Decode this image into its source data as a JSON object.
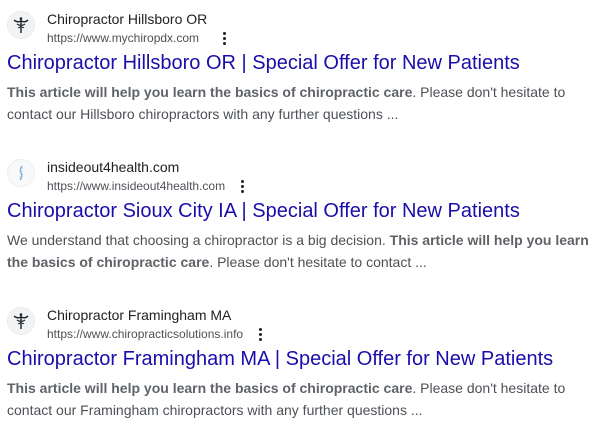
{
  "results": [
    {
      "site_name": "Chiropractor Hillsboro OR",
      "url": "https://www.mychiropdx.com",
      "favicon": "caduceus-icon",
      "title": "Chiropractor Hillsboro OR | Special Offer for New Patients",
      "snippet_bold_1": "This article will help you learn the basics of chiropractic care",
      "snippet_text_1": ". Please don't hesitate to contact our Hillsboro chiropractors with any further questions ..."
    },
    {
      "site_name": "insideout4health.com",
      "url": "https://www.insideout4health.com",
      "favicon": "spine-icon",
      "title": "Chiropractor Sioux City IA | Special Offer for New Patients",
      "snippet_text_1": "We understand that choosing a chiropractor is a big decision. ",
      "snippet_bold_1": "This article will help you learn the basics of chiropractic care",
      "snippet_text_2": ". Please don't hesitate to contact ..."
    },
    {
      "site_name": "Chiropractor Framingham MA",
      "url": "https://www.chiropracticsolutions.info",
      "favicon": "caduceus-icon",
      "title": "Chiropractor Framingham MA | Special Offer for New Patients",
      "snippet_bold_1": "This article will help you learn the basics of chiropractic care",
      "snippet_text_1": ". Please don't hesitate to contact our Framingham chiropractors with any further questions ..."
    }
  ],
  "colors": {
    "link": "#1a0dab",
    "snippet": "#4d5156",
    "text": "#202124"
  }
}
